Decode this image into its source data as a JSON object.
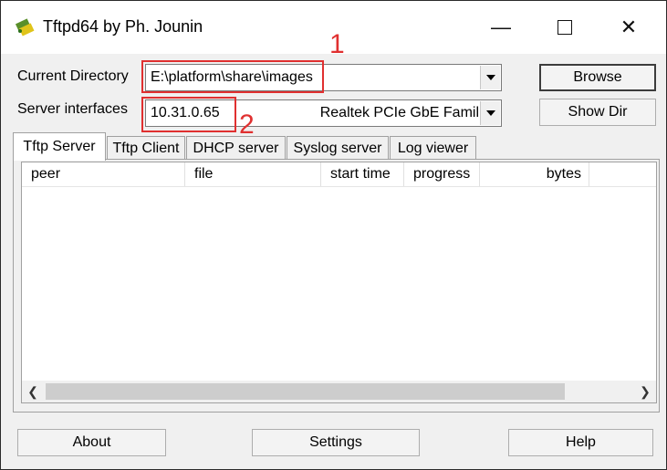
{
  "window": {
    "title": "Tftpd64 by Ph. Jounin",
    "controls": {
      "minimize": "—",
      "close": "✕"
    }
  },
  "form": {
    "current_directory_label": "Current Directory",
    "current_directory_value": "E:\\platform\\share\\images",
    "server_interfaces_label": "Server interfaces",
    "server_ip": "10.31.0.65",
    "server_adapter": "Realtek PCIe GbE Famil"
  },
  "buttons": {
    "browse": "Browse",
    "show_dir": "Show Dir",
    "about": "About",
    "settings": "Settings",
    "help": "Help"
  },
  "tabs": [
    "Tftp Server",
    "Tftp Client",
    "DHCP server",
    "Syslog server",
    "Log viewer"
  ],
  "active_tab": "Tftp Server",
  "table": {
    "columns": [
      "peer",
      "file",
      "start time",
      "progress",
      "bytes"
    ],
    "rows": []
  },
  "annotations": [
    "1",
    "2"
  ],
  "colors": {
    "annotation": "#e03030",
    "window_bg": "#f0f0f0"
  }
}
